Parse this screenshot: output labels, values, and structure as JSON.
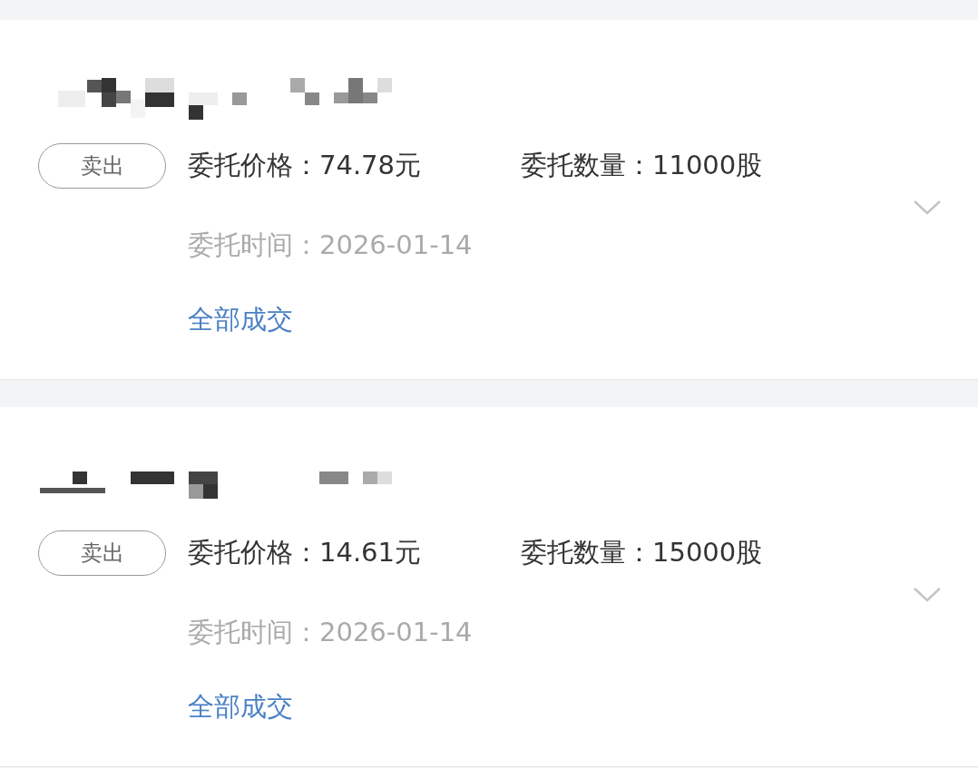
{
  "orders": [
    {
      "side": "卖出",
      "price": "委托价格：74.78元",
      "quantity": "委托数量：11000股",
      "time": "委托时间：2026-01-14",
      "status": "全部成交"
    },
    {
      "side": "卖出",
      "price": "委托价格：14.61元",
      "quantity": "委托数量：15000股",
      "time": "委托时间：2026-01-14",
      "status": "全部成交"
    }
  ]
}
